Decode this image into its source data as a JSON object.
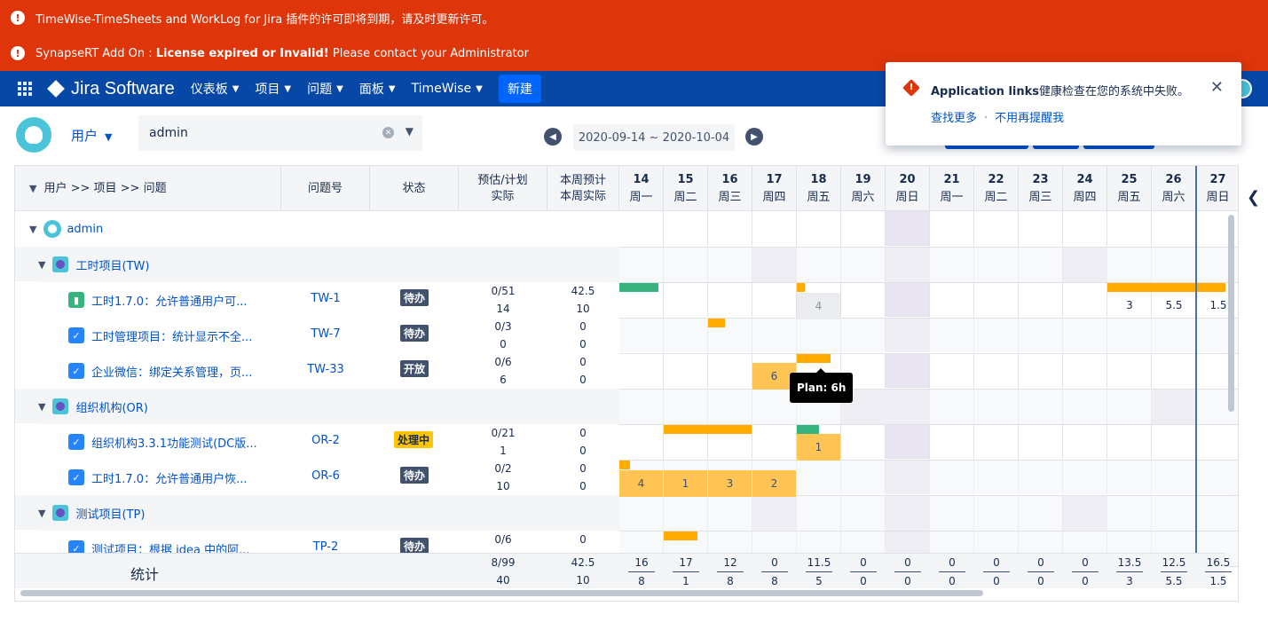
{
  "banners": [
    {
      "text": "TimeWise-TimeSheets and WorkLog for Jira 插件的许可即将到期，请及时更新许可。"
    },
    {
      "prefix": "SynapseRT Add On : ",
      "bold": "License expired or Invalid!",
      "suffix": " Please contact your Administrator"
    }
  ],
  "nav": {
    "logo": "Jira Software",
    "items": [
      "仪表板",
      "项目",
      "问题",
      "面板",
      "TimeWise"
    ],
    "create": "新建"
  },
  "toolbar": {
    "user_label": "用户",
    "search_value": "admin",
    "date_range": "2020-09-14 ~ 2020-10-04"
  },
  "popup": {
    "title_bold": "Application links",
    "title_rest": "健康检查在您的系统中失败。",
    "link1": "查找更多",
    "sep": "·",
    "link2": "不用再提醒我"
  },
  "table": {
    "headers": {
      "tree": "用户 >> 项目 >> 问题",
      "key": "问题号",
      "status": "状态",
      "est_top": "预估/计划",
      "est_bottom": "实际",
      "week_top": "本周预计",
      "week_bottom": "本周实际"
    },
    "days": [
      {
        "d": "14",
        "w": "周一"
      },
      {
        "d": "15",
        "w": "周二"
      },
      {
        "d": "16",
        "w": "周三"
      },
      {
        "d": "17",
        "w": "周四"
      },
      {
        "d": "18",
        "w": "周五"
      },
      {
        "d": "19",
        "w": "周六"
      },
      {
        "d": "20",
        "w": "周日"
      },
      {
        "d": "21",
        "w": "周一"
      },
      {
        "d": "22",
        "w": "周二"
      },
      {
        "d": "23",
        "w": "周三"
      },
      {
        "d": "24",
        "w": "周四"
      },
      {
        "d": "25",
        "w": "周五"
      },
      {
        "d": "26",
        "w": "周六"
      },
      {
        "d": "27",
        "w": "周日"
      }
    ],
    "user": "admin",
    "groups": [
      "工时项目(TW)",
      "组织机构(OR)",
      "测试项目(TP)"
    ],
    "issues": [
      {
        "title": "工时1.7.0：允许普通用户可...",
        "key": "TW-1",
        "status": "待办",
        "est": "0/51",
        "act": "14",
        "wk1": "42.5",
        "wk2": "10"
      },
      {
        "title": "工时管理项目：统计显示不全...",
        "key": "TW-7",
        "status": "待办",
        "est": "0/3",
        "act": "0",
        "wk1": "0",
        "wk2": "0"
      },
      {
        "title": "企业微信：绑定关系管理，页...",
        "key": "TW-33",
        "status": "开放",
        "est": "0/6",
        "act": "6",
        "wk1": "0",
        "wk2": "0"
      },
      {
        "title": "组织机构3.3.1功能测试(DC版...",
        "key": "OR-2",
        "status": "处理中",
        "est": "0/21",
        "act": "1",
        "wk1": "0",
        "wk2": "0"
      },
      {
        "title": "工时1.7.0：允许普通用户恢...",
        "key": "OR-6",
        "status": "待办",
        "est": "0/2",
        "act": "10",
        "wk1": "0",
        "wk2": "0"
      },
      {
        "title": "测试项目：根据 idea 中的阿...",
        "key": "TP-2",
        "status": "待办",
        "est": "0/6",
        "act": "",
        "wk1": "0",
        "wk2": ""
      }
    ],
    "cells": {
      "tw1_18": "4",
      "tw1_25": "3",
      "tw1_26": "5.5",
      "tw1_27": "1.5",
      "tw33_17": "6",
      "or2_18": "1",
      "or6_14": "4",
      "or6_15": "1",
      "or6_16": "3",
      "or6_17": "2"
    },
    "tooltip": "Plan: 6h",
    "footer": {
      "label": "统计",
      "est": "8/99",
      "act": "40",
      "wk1": "42.5",
      "wk2": "10",
      "days": [
        [
          "16",
          "8"
        ],
        [
          "17",
          "1"
        ],
        [
          "12",
          "8"
        ],
        [
          "0",
          "8"
        ],
        [
          "11.5",
          "5"
        ],
        [
          "0",
          "0"
        ],
        [
          "0",
          "0"
        ],
        [
          "0",
          "0"
        ],
        [
          "0",
          "0"
        ],
        [
          "0",
          "0"
        ],
        [
          "0",
          "0"
        ],
        [
          "13.5",
          "3"
        ],
        [
          "12.5",
          "5.5"
        ],
        [
          "16.5",
          "1.5"
        ]
      ]
    }
  }
}
